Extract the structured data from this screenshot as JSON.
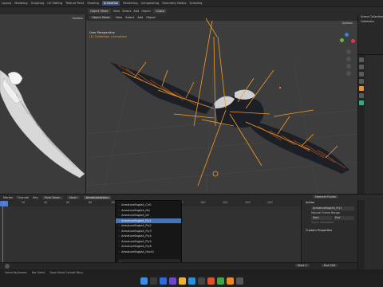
{
  "menu": [
    "Layout",
    "Modeling",
    "Sculpting",
    "UV Editing",
    "Texture Paint",
    "Shading",
    "Animation",
    "Rendering",
    "Compositing",
    "Geometry Nodes",
    "Scripting"
  ],
  "active_workspace": "Animation",
  "viewport": {
    "mode": "Object Mode",
    "menus": [
      "View",
      "Select",
      "Add",
      "Object"
    ],
    "transform": "Global",
    "perspective_label": "User Perspective",
    "collection_label": "(1) Collection | Armature",
    "options_label": "Options"
  },
  "left_viewport": {
    "options_label": "Options"
  },
  "outliner": {
    "items": [
      "Scene Collection",
      "Collection"
    ]
  },
  "dopesheet": {
    "menus": [
      "Marker",
      "Channel",
      "Key"
    ],
    "push_down_label": "Push Down",
    "stash_label": "Stash",
    "action_name": "ArmatureAction",
    "nearest_frame_label": "Nearest Frame",
    "ruler_ticks": [
      "20",
      "40",
      "60",
      "80",
      "100",
      "120",
      "140",
      "160",
      "180",
      "200",
      "220",
      "240"
    ],
    "current_frame": "1"
  },
  "action_dropdown": {
    "items": [
      "ArmatureEagleA_Cir0",
      "ArmatureEagleA_Dis",
      "ArmatureEagleA_Idl",
      "ArmatureEagleA_Fly1",
      "ArmatureEagleA_Fly2",
      "ArmatureEagleA_Fly3",
      "ArmatureEagleA_Fly4",
      "ArmatureEagleA_Fly5",
      "ArmatureEagleA_Fly6",
      "ArmatureEagleA_Hunt1"
    ],
    "selected_index": 3,
    "search_placeholder": ""
  },
  "side_panel": {
    "action_header": "Action",
    "action_value": "ArmatureEagleA_Fly1",
    "manual_frame_range": "Manual Frame Range",
    "start_label": "Start",
    "end_label": "End",
    "cyclic_label": "Cyclic Animation",
    "custom_props": "Custom Properties"
  },
  "playback": {
    "start_label": "Start",
    "start_value": "1",
    "end_label": "End",
    "end_value": "250"
  },
  "statusbar": {
    "items": [
      "Select Keyframes",
      "Box Select",
      "Dope Sheet Context Menu"
    ]
  },
  "colors": {
    "accent": "#4772b3",
    "bone": "#f49b27",
    "viewport_bg": "#3d3d3d"
  }
}
